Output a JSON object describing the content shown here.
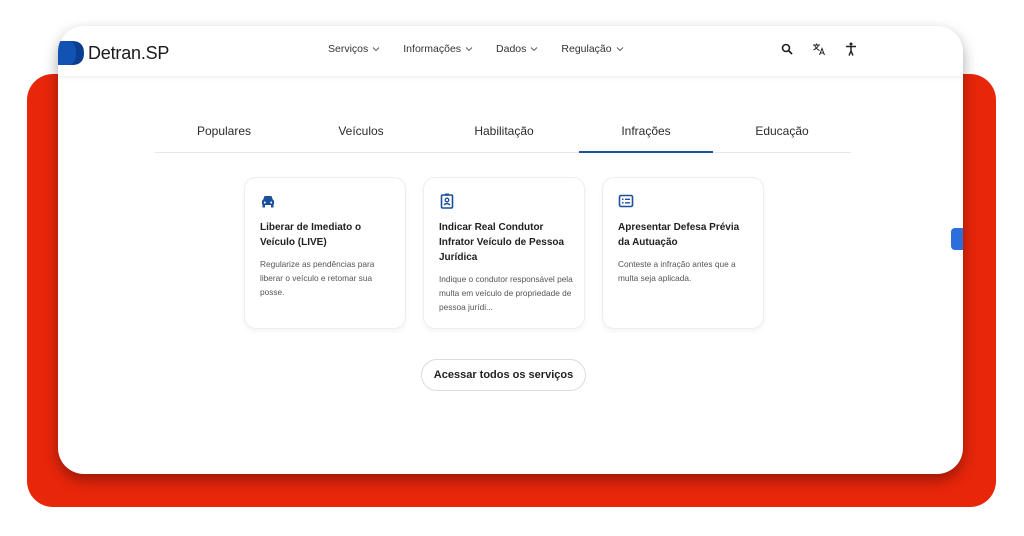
{
  "brand": {
    "name_a": "Detran",
    "name_b": ".SP"
  },
  "nav": [
    {
      "label": "Serviços"
    },
    {
      "label": "Informações"
    },
    {
      "label": "Dados"
    },
    {
      "label": "Regulação"
    }
  ],
  "tools": {
    "search": "search-icon",
    "translate": "translate-icon",
    "accessibility": "accessibility-icon"
  },
  "tabs": [
    {
      "label": "Populares"
    },
    {
      "label": "Veículos"
    },
    {
      "label": "Habilitação"
    },
    {
      "label": "Infrações",
      "active": true
    },
    {
      "label": "Educação"
    }
  ],
  "cards": [
    {
      "icon": "car-icon",
      "title": "Liberar de Imediato o Veículo (LIVE)",
      "desc": "Regularize as pendências para liberar o veículo e retomar sua posse."
    },
    {
      "icon": "badge-icon",
      "title": "Indicar Real Condutor Infrator Veículo de Pessoa Jurídica",
      "desc": "Indique o condutor responsável pela multa em veículo de propriedade de pessoa jurídi..."
    },
    {
      "icon": "document-list-icon",
      "title": "Apresentar Defesa Prévia da Autuação",
      "desc": "Conteste a infração antes que a multa seja aplicada."
    }
  ],
  "cta": {
    "label": "Acessar todos os serviços"
  },
  "colors": {
    "accent": "#1c4f9c",
    "background": "#e8260a"
  }
}
